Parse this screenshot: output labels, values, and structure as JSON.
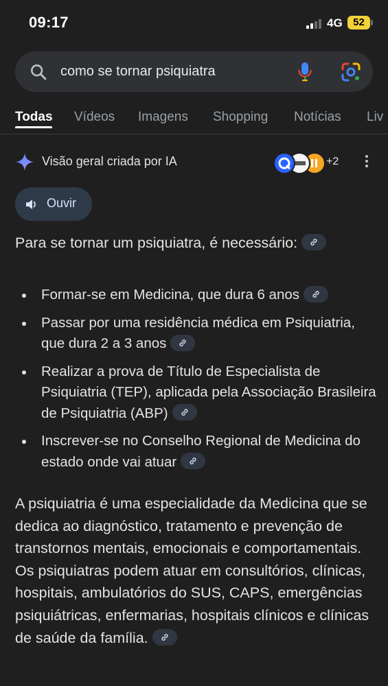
{
  "status_bar": {
    "time": "09:17",
    "network": "4G",
    "battery": "52"
  },
  "search": {
    "query": "como se tornar psiquiatra"
  },
  "tabs": [
    {
      "label": "Todas",
      "active": true
    },
    {
      "label": "Vídeos",
      "active": false
    },
    {
      "label": "Imagens",
      "active": false
    },
    {
      "label": "Shopping",
      "active": false
    },
    {
      "label": "Notícias",
      "active": false
    },
    {
      "label": "Liv",
      "active": false
    }
  ],
  "ai_overview": {
    "title": "Visão geral criada por IA",
    "sources_more": "+2",
    "listen_label": "Ouvir",
    "intro": "Para se tornar um psiquiatra, é necessário:",
    "bullets": [
      "Formar-se em Medicina, que dura 6 anos",
      "Passar por uma residência médica em Psiquiatria, que dura 2 a 3 anos",
      "Realizar a prova de Título de Especialista de Psiquiatria (TEP), aplicada pela Associação Brasileira de Psiquiatria (ABP)",
      "Inscrever-se no Conselho Regional de Medicina do estado onde vai atuar"
    ],
    "paragraph": "A psiquiatria é uma especialidade da Medicina que se dedica ao diagnóstico, tratamento e prevenção de transtornos mentais, emocionais e comportamentais. Os psiquiatras podem atuar em consultórios, clínicas, hospitais, ambulatórios do SUS, CAPS, emergências psiquiátricas, enfermarias, hospitais clínicos e clínicas de saúde da família."
  },
  "colors": {
    "background": "#1f1f1f",
    "search_bar": "#303134",
    "battery": "#f2d13a",
    "listen_button": "#2f3a48",
    "link_chip": "#303742"
  },
  "icons": [
    "search-icon",
    "microphone-icon",
    "google-lens-icon",
    "gemini-sparkle-icon",
    "more-vert-icon",
    "speaker-icon",
    "link-icon"
  ]
}
